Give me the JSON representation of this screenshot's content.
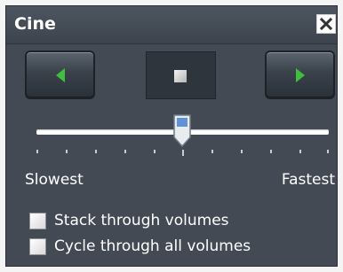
{
  "window": {
    "title": "Cine"
  },
  "controls": {
    "prev_icon": "triangle-left-icon",
    "stop_icon": "stop-square-icon",
    "next_icon": "triangle-right-icon",
    "icon_color": "#3fbf3f"
  },
  "speed_slider": {
    "min_label": "Slowest",
    "max_label": "Fastest",
    "value_fraction": 0.5
  },
  "options": [
    {
      "label": "Stack through volumes",
      "checked": false
    },
    {
      "label": "Cycle through all volumes",
      "checked": false
    }
  ]
}
